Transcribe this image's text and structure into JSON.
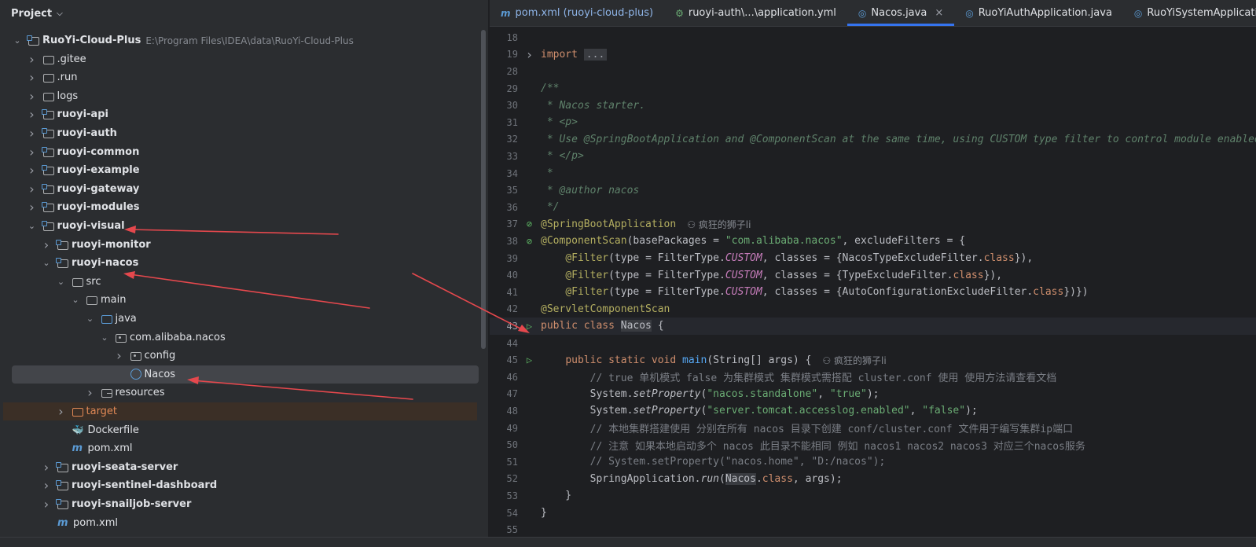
{
  "project_panel": {
    "title": "Project",
    "tree": [
      {
        "label": "RuoYi-Cloud-Plus",
        "path": "E:\\Program Files\\IDEA\\data\\RuoYi-Cloud-Plus",
        "indent": 0,
        "arrow": "down",
        "icon": "module",
        "bold": true
      },
      {
        "label": ".gitee",
        "indent": 1,
        "arrow": "right",
        "icon": "folder"
      },
      {
        "label": ".run",
        "indent": 1,
        "arrow": "right",
        "icon": "folder"
      },
      {
        "label": "logs",
        "indent": 1,
        "arrow": "right",
        "icon": "folder"
      },
      {
        "label": "ruoyi-api",
        "indent": 1,
        "arrow": "right",
        "icon": "module",
        "bold": true
      },
      {
        "label": "ruoyi-auth",
        "indent": 1,
        "arrow": "right",
        "icon": "module",
        "bold": true
      },
      {
        "label": "ruoyi-common",
        "indent": 1,
        "arrow": "right",
        "icon": "module",
        "bold": true
      },
      {
        "label": "ruoyi-example",
        "indent": 1,
        "arrow": "right",
        "icon": "module",
        "bold": true
      },
      {
        "label": "ruoyi-gateway",
        "indent": 1,
        "arrow": "right",
        "icon": "module",
        "bold": true
      },
      {
        "label": "ruoyi-modules",
        "indent": 1,
        "arrow": "right",
        "icon": "module",
        "bold": true
      },
      {
        "label": "ruoyi-visual",
        "indent": 1,
        "arrow": "down",
        "icon": "module",
        "bold": true
      },
      {
        "label": "ruoyi-monitor",
        "indent": 2,
        "arrow": "right",
        "icon": "module",
        "bold": true
      },
      {
        "label": "ruoyi-nacos",
        "indent": 2,
        "arrow": "down",
        "icon": "module",
        "bold": true
      },
      {
        "label": "src",
        "indent": 3,
        "arrow": "down",
        "icon": "folder"
      },
      {
        "label": "main",
        "indent": 4,
        "arrow": "down",
        "icon": "folder"
      },
      {
        "label": "java",
        "indent": 5,
        "arrow": "down",
        "icon": "src"
      },
      {
        "label": "com.alibaba.nacos",
        "indent": 6,
        "arrow": "down",
        "icon": "pkg"
      },
      {
        "label": "config",
        "indent": 7,
        "arrow": "right",
        "icon": "pkg"
      },
      {
        "label": "Nacos",
        "indent": 7,
        "arrow": "",
        "icon": "javaclass",
        "selected": true
      },
      {
        "label": "resources",
        "indent": 5,
        "arrow": "right",
        "icon": "res"
      },
      {
        "label": "target",
        "indent": 3,
        "arrow": "right",
        "icon": "target",
        "excluded": true
      },
      {
        "label": "Dockerfile",
        "indent": 3,
        "arrow": "",
        "icon": "docker"
      },
      {
        "label": "pom.xml",
        "indent": 3,
        "arrow": "",
        "icon": "mvn"
      },
      {
        "label": "ruoyi-seata-server",
        "indent": 2,
        "arrow": "right",
        "icon": "module",
        "bold": true
      },
      {
        "label": "ruoyi-sentinel-dashboard",
        "indent": 2,
        "arrow": "right",
        "icon": "module",
        "bold": true
      },
      {
        "label": "ruoyi-snailjob-server",
        "indent": 2,
        "arrow": "right",
        "icon": "module",
        "bold": true
      },
      {
        "label": "pom.xml",
        "indent": 2,
        "arrow": "",
        "icon": "mvn"
      }
    ]
  },
  "tabs": [
    {
      "label": "pom.xml (ruoyi-cloud-plus)",
      "icon": "maven-icon",
      "glyph": "m"
    },
    {
      "label": "ruoyi-auth\\...\\application.yml",
      "icon": "yaml-icon",
      "glyph": "⚙"
    },
    {
      "label": "Nacos.java",
      "icon": "java-class-icon",
      "glyph": "◎",
      "active": true,
      "close": "×"
    },
    {
      "label": "RuoYiAuthApplication.java",
      "icon": "java-class-icon",
      "glyph": "◎"
    },
    {
      "label": "RuoYiSystemApplication.java",
      "icon": "java-class-icon",
      "glyph": "◎"
    }
  ],
  "code": {
    "author_hint": "疯狂的狮子li",
    "lines": [
      {
        "n": "18",
        "html": ""
      },
      {
        "n": "19",
        "gutter": "fold",
        "html": "<span class=\"kw\">import</span> <span class=\"folded\">...</span>"
      },
      {
        "n": "28",
        "html": ""
      },
      {
        "n": "29",
        "html": "<span class=\"doc\">/**</span>"
      },
      {
        "n": "30",
        "html": "<span class=\"doc\"> * Nacos starter.</span>"
      },
      {
        "n": "31",
        "html": "<span class=\"doc\"> * &lt;p&gt;</span>"
      },
      {
        "n": "32",
        "html": "<span class=\"doc\"> * Use @SpringBootApplication and @ComponentScan at the same time, using CUSTOM type filter to control module enabled.</span>"
      },
      {
        "n": "33",
        "html": "<span class=\"doc\"> * &lt;/p&gt;</span>"
      },
      {
        "n": "34",
        "html": "<span class=\"doc\"> *</span>"
      },
      {
        "n": "35",
        "html": "<span class=\"doc\"> * @author nacos</span>"
      },
      {
        "n": "36",
        "html": "<span class=\"doc\"> */</span>"
      },
      {
        "n": "37",
        "gutter": "bean",
        "html": "<span class=\"ann\">@SpringBootApplication</span>",
        "hint": true
      },
      {
        "n": "38",
        "gutter": "bean",
        "html": "<span class=\"ann\">@ComponentScan</span><span class=\"src\">(basePackages = </span><span class=\"str\">\"com.alibaba.nacos\"</span><span class=\"src\">, excludeFilters = {</span>"
      },
      {
        "n": "39",
        "html": "<span class=\"src\">    </span><span class=\"ann\">@Filter</span><span class=\"src\">(type = FilterType.</span><span class=\"it\">CUSTOM</span><span class=\"src\">, classes = {NacosTypeExcludeFilter.</span><span class=\"kw\">class</span><span class=\"src\">}),</span>"
      },
      {
        "n": "40",
        "html": "<span class=\"src\">    </span><span class=\"ann\">@Filter</span><span class=\"src\">(type = FilterType.</span><span class=\"it\">CUSTOM</span><span class=\"src\">, classes = {TypeExcludeFilter.</span><span class=\"kw\">class</span><span class=\"src\">}),</span>"
      },
      {
        "n": "41",
        "html": "<span class=\"src\">    </span><span class=\"ann\">@Filter</span><span class=\"src\">(type = FilterType.</span><span class=\"it\">CUSTOM</span><span class=\"src\">, classes = {AutoConfigurationExcludeFilter.</span><span class=\"kw\">class</span><span class=\"src\">})})</span>"
      },
      {
        "n": "42",
        "html": "<span class=\"ann\">@ServletComponentScan</span>"
      },
      {
        "n": "43",
        "gutter": "run",
        "current": true,
        "html": "<span class=\"kw\">public class </span><span class=\"src hl\">Nacos</span><span class=\"src\"> {</span>"
      },
      {
        "n": "44",
        "html": ""
      },
      {
        "n": "45",
        "gutter": "run",
        "html": "<span class=\"src\">    </span><span class=\"kw\">public static void </span><span class=\"fn\">main</span><span class=\"src\">(String[] args) {</span>",
        "hint": true
      },
      {
        "n": "46",
        "html": "<span class=\"cmt\">        // true 单机模式 false 为集群模式 集群模式需搭配 cluster.conf 使用 使用方法请查看文档</span>"
      },
      {
        "n": "47",
        "html": "<span class=\"src\">        System.</span><span class=\"src st\">setProperty</span><span class=\"src\">(</span><span class=\"str\">\"nacos.standalone\"</span><span class=\"src\">, </span><span class=\"str\">\"true\"</span><span class=\"src\">);</span>"
      },
      {
        "n": "48",
        "html": "<span class=\"src\">        System.</span><span class=\"src st\">setProperty</span><span class=\"src\">(</span><span class=\"str\">\"server.tomcat.accesslog.enabled\"</span><span class=\"src\">, </span><span class=\"str\">\"false\"</span><span class=\"src\">);</span>"
      },
      {
        "n": "49",
        "html": "<span class=\"cmt\">        // 本地集群搭建使用 分别在所有 nacos 目录下创建 conf/cluster.conf 文件用于编写集群ip端口</span>"
      },
      {
        "n": "50",
        "html": "<span class=\"cmt\">        // 注意 如果本地启动多个 nacos 此目录不能相同 例如 nacos1 nacos2 nacos3 对应三个nacos服务</span>"
      },
      {
        "n": "51",
        "html": "<span class=\"cmt\">        // System.setProperty(\"nacos.home\", \"D:/nacos\");</span>"
      },
      {
        "n": "52",
        "html": "<span class=\"src\">        SpringApplication.</span><span class=\"src st\">run</span><span class=\"src\">(</span><span class=\"src hl\">Nacos</span><span class=\"src\">.</span><span class=\"kw\">class</span><span class=\"src\">, args);</span>"
      },
      {
        "n": "53",
        "html": "<span class=\"src\">    }</span>"
      },
      {
        "n": "54",
        "html": "<span class=\"src\">}</span>"
      },
      {
        "n": "55",
        "html": ""
      }
    ]
  },
  "colors": {
    "annotation_arrows": "#e5484d",
    "accent": "#3574f0"
  }
}
